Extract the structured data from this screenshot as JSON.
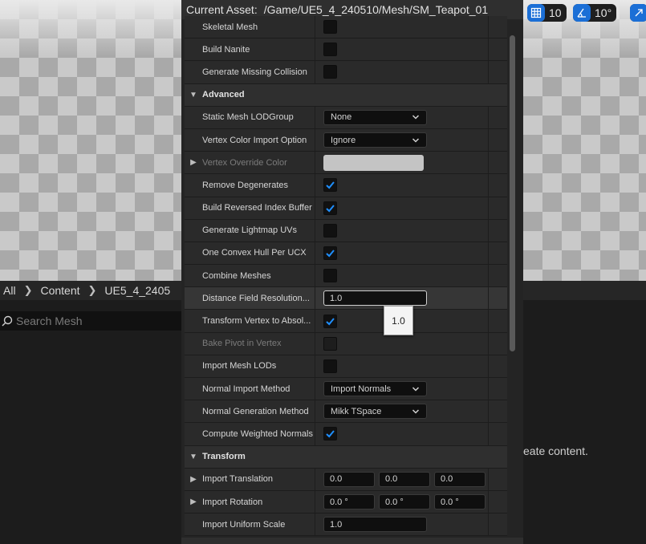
{
  "viewport": {
    "grid_snap_value": "10",
    "angle_snap_value": "10°"
  },
  "content_browser": {
    "breadcrumb": [
      "All",
      "Content",
      "UE5_4_2405"
    ],
    "search_placeholder": "Search Mesh",
    "empty_message": "eate content."
  },
  "dialog": {
    "title_label": "Current Asset:",
    "title_path": "/Game/UE5_4_240510/Mesh/SM_Teapot_01",
    "rows": [
      {
        "label": "Skeletal Mesh",
        "type": "check",
        "checked": false
      },
      {
        "label": "Build Nanite",
        "type": "check",
        "checked": false
      },
      {
        "label": "Generate Missing Collision",
        "type": "check",
        "checked": false
      },
      {
        "label": "Advanced",
        "type": "category",
        "expanded": true
      },
      {
        "label": "Static Mesh LODGroup",
        "type": "combo",
        "value": "None"
      },
      {
        "label": "Vertex Color Import Option",
        "type": "combo",
        "value": "Ignore"
      },
      {
        "label": "Vertex Override Color",
        "type": "color",
        "color": "#c4c4c4",
        "disabled": true
      },
      {
        "label": "Remove Degenerates",
        "type": "check",
        "checked": true
      },
      {
        "label": "Build Reversed Index Buffer",
        "type": "check",
        "checked": true
      },
      {
        "label": "Generate Lightmap UVs",
        "type": "check",
        "checked": false
      },
      {
        "label": "One Convex Hull Per UCX",
        "type": "check",
        "checked": true
      },
      {
        "label": "Combine Meshes",
        "type": "check",
        "checked": false
      },
      {
        "label": "Distance Field Resolution...",
        "type": "number",
        "value": "1.0",
        "active": true
      },
      {
        "label": "Transform Vertex to Absol...",
        "type": "check",
        "checked": true
      },
      {
        "label": "Bake Pivot in Vertex",
        "type": "check",
        "checked": false,
        "disabled": true
      },
      {
        "label": "Import Mesh LODs",
        "type": "check",
        "checked": false
      },
      {
        "label": "Normal Import Method",
        "type": "combo",
        "value": "Import Normals"
      },
      {
        "label": "Normal Generation Method",
        "type": "combo",
        "value": "Mikk TSpace"
      },
      {
        "label": "Compute Weighted Normals",
        "type": "check",
        "checked": true
      },
      {
        "label": "Transform",
        "type": "category",
        "expanded": true
      },
      {
        "label": "Import Translation",
        "type": "vector",
        "values": [
          "0.0",
          "0.0",
          "0.0"
        ]
      },
      {
        "label": "Import Rotation",
        "type": "vector",
        "values": [
          "0.0 °",
          "0.0 °",
          "0.0 °"
        ]
      },
      {
        "label": "Import Uniform Scale",
        "type": "number",
        "value": "1.0"
      }
    ],
    "tooltip": "1.0"
  },
  "colors": {
    "accent": "#1b6fd6",
    "check": "#1f8fff"
  }
}
